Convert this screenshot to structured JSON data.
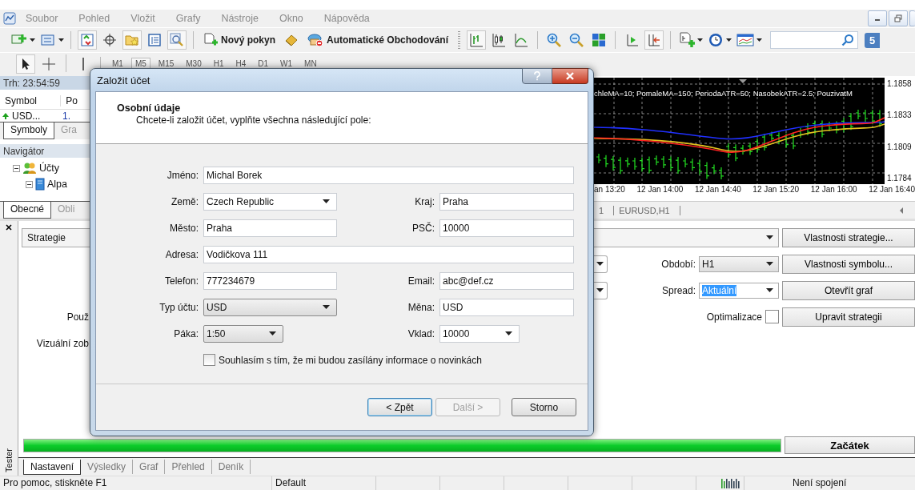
{
  "menu": [
    "Soubor",
    "Pohled",
    "Vložit",
    "Grafy",
    "Nástroje",
    "Okno",
    "Nápověda"
  ],
  "toolbar": {
    "new_order": "Nový pokyn",
    "auto_trading": "Automatické Obchodování",
    "notification_count": "5"
  },
  "timeframes": [
    {
      "label": "M1",
      "selected": false
    },
    {
      "label": "M5",
      "selected": true
    },
    {
      "label": "M15",
      "selected": false
    },
    {
      "label": "M30",
      "selected": false
    },
    {
      "label": "H1",
      "selected": false
    },
    {
      "label": "H4",
      "selected": false
    },
    {
      "label": "D1",
      "selected": false
    },
    {
      "label": "W1",
      "selected": false
    },
    {
      "label": "MN",
      "selected": false
    }
  ],
  "market_watch": {
    "time": "Trh: 23:54:59",
    "columns": [
      "Symbol",
      "Po"
    ],
    "rows": [
      {
        "cells": [
          "USD...",
          "1."
        ]
      }
    ],
    "tabs": [
      {
        "label": "Symboly",
        "selected": true
      },
      {
        "label": "Gra",
        "selected": false
      }
    ]
  },
  "navigator": {
    "title": "Navigátor",
    "tree": [
      {
        "label": "Účty",
        "expanded": true,
        "children": [
          {
            "label": "Alpa",
            "expanded": true
          }
        ]
      }
    ],
    "tabs": [
      {
        "label": "Obecné",
        "selected": true
      },
      {
        "label": "Obli",
        "selected": false
      }
    ]
  },
  "chart": {
    "legend": "chleMA=10; PomaleMA=150; PeriodaATR=50; NasobekATR=2.5; PouzivatM",
    "price_labels": [
      "1.1858",
      "1.1833",
      "1.1809",
      "1.1784"
    ],
    "time_labels": [
      "an 13:20",
      "12 Jan 14:00",
      "12 Jan 14:40",
      "12 Jan 15:20",
      "12 Jan 16:00",
      "12 Jan 16:40"
    ],
    "tabs": [
      "1",
      "EURUSD,H1"
    ]
  },
  "dialog": {
    "title": "Založit účet",
    "heading": "Osobní údaje",
    "subtitle": "Chcete-li založit účet, vyplňte všechna následující pole:",
    "rows": [
      [
        {
          "label": "Jméno:",
          "value": "Michal Borek",
          "kind": "text"
        }
      ],
      [
        {
          "label": "Země:",
          "value": "Czech Republic",
          "kind": "combo"
        },
        {
          "label": "Kraj:",
          "value": "Praha",
          "kind": "text"
        }
      ],
      [
        {
          "label": "Město:",
          "value": "Praha",
          "kind": "text"
        },
        {
          "label": "PSČ:",
          "value": "10000",
          "kind": "text"
        }
      ],
      [
        {
          "label": "Adresa:",
          "value": "Vodičkova 111",
          "kind": "text"
        }
      ],
      [
        {
          "label": "Telefon:",
          "value": "777234679",
          "kind": "text"
        },
        {
          "label": "Email:",
          "value": "abc@def.cz",
          "kind": "text"
        }
      ],
      [
        {
          "label": "Typ účtu:",
          "value": "USD",
          "kind": "list"
        },
        {
          "label": "Měna:",
          "value": "USD",
          "kind": "text"
        }
      ],
      [
        {
          "label": "Páka:",
          "value": "1:50",
          "kind": "list-short"
        },
        {
          "label": "Vklad:",
          "value": "10000",
          "kind": "combo-short"
        }
      ]
    ],
    "newsletter": {
      "label": "Souhlasím s tím, že mi budou zasílány informace o novinkách",
      "checked": false
    },
    "buttons": [
      {
        "label": "< Zpět",
        "disabled": false,
        "default": true
      },
      {
        "label": "Další >",
        "disabled": true,
        "default": false
      },
      {
        "label": "Storno",
        "disabled": false,
        "default": false
      }
    ]
  },
  "tester": {
    "side_label": "Tester",
    "strategy": "Strategie",
    "label_1": "Použ",
    "label_2": "Vizuální zob",
    "period_label": "Období:",
    "period": "H1",
    "spread_label": "Spread:",
    "spread": "Aktuální",
    "optimization": {
      "label": "Optimalizace",
      "checked": false
    },
    "buttons": [
      "Vlastnosti strategie...",
      "Vlastnosti symbolu...",
      "Otevřít graf",
      "Upravit strategii"
    ],
    "progress": {
      "level": 1
    },
    "start": "Začátek",
    "tabs": [
      {
        "label": "Nastavení",
        "selected": true
      },
      {
        "label": "Výsledky",
        "selected": false
      },
      {
        "label": "Graf",
        "selected": false
      },
      {
        "label": "Přehled",
        "selected": false
      },
      {
        "label": "Deník",
        "selected": false
      }
    ]
  },
  "status_bar": {
    "help": "Pro pomoc, stiskněte F1",
    "profile": "Default",
    "connection": "Není spojení"
  }
}
